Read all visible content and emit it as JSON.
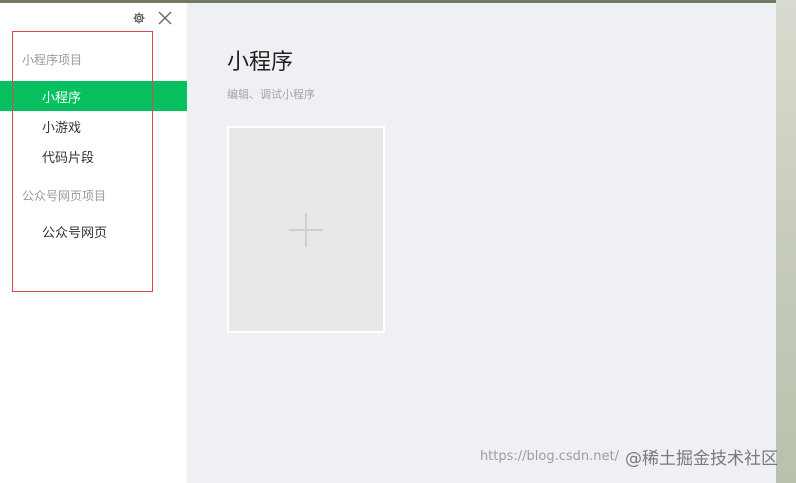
{
  "sidebar": {
    "sections": [
      {
        "title": "小程序项目",
        "items": [
          {
            "label": "小程序",
            "active": true
          },
          {
            "label": "小游戏",
            "active": false
          },
          {
            "label": "代码片段",
            "active": false
          }
        ]
      },
      {
        "title": "公众号网页项目",
        "items": [
          {
            "label": "公众号网页",
            "active": false
          }
        ]
      }
    ]
  },
  "main": {
    "title": "小程序",
    "subtitle": "编辑、调试小程序"
  },
  "watermark": {
    "url": "https://blog.csdn.net/",
    "brand": "@稀土掘金技术社区"
  },
  "colors": {
    "accent": "#07c160",
    "highlight_box": "#e0454e",
    "main_bg": "#eff0f3"
  },
  "icons": [
    "settings-gear-icon",
    "close-icon",
    "plus-icon"
  ]
}
